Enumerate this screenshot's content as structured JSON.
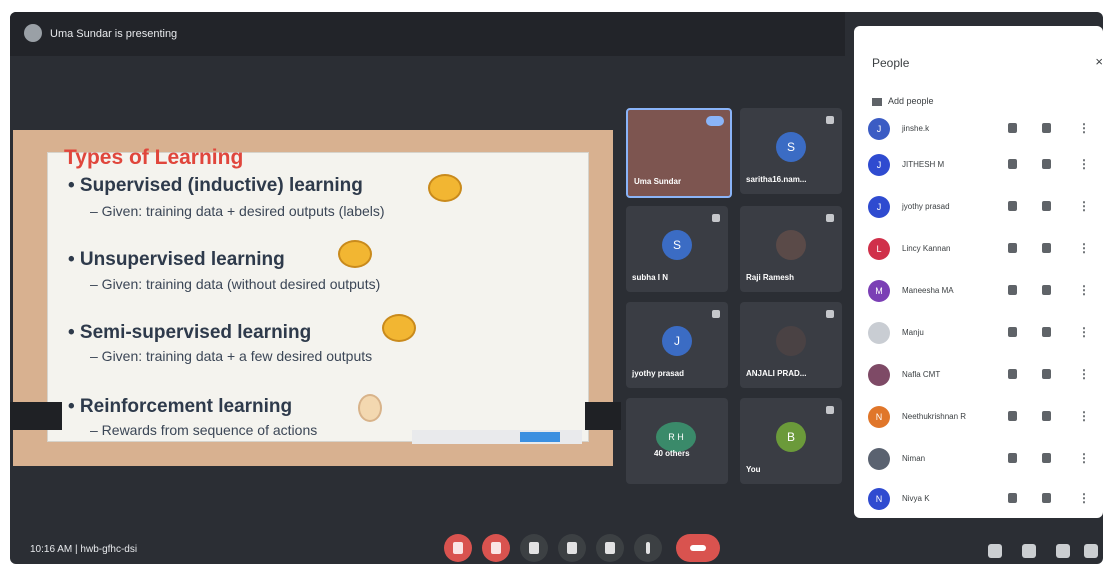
{
  "header": {
    "presenting_text": "Uma Sundar is presenting"
  },
  "slide": {
    "title": "Types of Learning",
    "bullets": [
      {
        "heading": "• Supervised (inductive) learning",
        "detail": "– Given: training data + desired outputs (labels)"
      },
      {
        "heading": "• Unsupervised learning",
        "detail": "– Given: training data (without desired outputs)"
      },
      {
        "heading": "• Semi-supervised learning",
        "detail": "– Given: training data + a few desired outputs"
      },
      {
        "heading": "• Reinforcement learning",
        "detail": "– Rewards from sequence of actions"
      }
    ]
  },
  "tiles": [
    {
      "name": "Uma Sundar",
      "initial": "",
      "color": "#7d5550"
    },
    {
      "name": "saritha16.nam...",
      "initial": "S",
      "color": "#3b6cc4"
    },
    {
      "name": "subha I N",
      "initial": "S",
      "color": "#3b6cc4"
    },
    {
      "name": "Raji Ramesh",
      "initial": "",
      "color": "#5a4a48"
    },
    {
      "name": "jyothy prasad",
      "initial": "J",
      "color": "#3b6cc4"
    },
    {
      "name": "ANJALI PRAD...",
      "initial": "",
      "color": "#4a4244"
    },
    {
      "name": "40 others",
      "initial": "R H",
      "color": "#3a8a6a"
    },
    {
      "name": "You",
      "initial": "B",
      "color": "#6b9a3a"
    }
  ],
  "people_panel": {
    "title": "People",
    "close": "×",
    "add_people": "Add people",
    "people": [
      {
        "name": "jinshe.k",
        "initial": "J",
        "color": "#3b5cc4"
      },
      {
        "name": "JITHESH M",
        "initial": "J",
        "color": "#2f4bd0"
      },
      {
        "name": "jyothy prasad",
        "initial": "J",
        "color": "#2f4bd0"
      },
      {
        "name": "Lincy Kannan",
        "initial": "L",
        "color": "#d0304a"
      },
      {
        "name": "Maneesha MA",
        "initial": "M",
        "color": "#7b3fb5"
      },
      {
        "name": "Manju",
        "initial": "",
        "color": "#c9cdd3"
      },
      {
        "name": "Nafla CMT",
        "initial": "",
        "color": "#7e4a66"
      },
      {
        "name": "Neethukrishnan R",
        "initial": "N",
        "color": "#e0762a"
      },
      {
        "name": "Niman",
        "initial": "",
        "color": "#5a6270"
      },
      {
        "name": "Nivya K",
        "initial": "N",
        "color": "#2f4bd0"
      }
    ]
  },
  "bottom_bar": {
    "meeting_info": "10:16 AM  |  hwb-gfhc-dsi"
  }
}
